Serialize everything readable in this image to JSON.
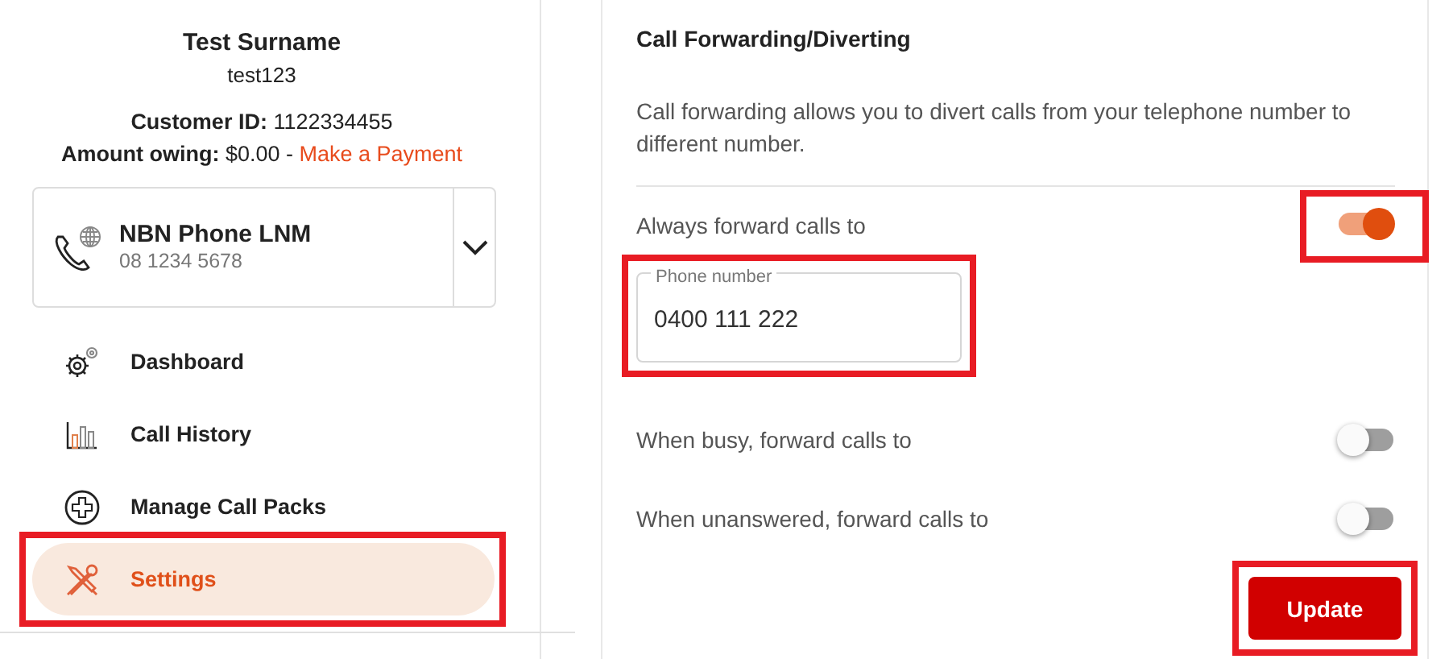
{
  "profile": {
    "name": "Test Surname",
    "username": "test123",
    "customer_id": "**Customer ID:** 1122334455",
    "amount": "**Amount owing:** $0.00 -",
    "payment_link": "Make a Payment"
  },
  "service": {
    "name": "NBN Phone LNM",
    "number": "08 1234 5678",
    "expanded": false
  },
  "nav": [
    {
      "label": "Dashboard",
      "selected": false,
      "highlighted": false
    },
    {
      "label": "Call History",
      "selected": false,
      "highlighted": false
    },
    {
      "label": "Manage Call Packs",
      "selected": false,
      "highlighted": false
    },
    {
      "label": "Settings",
      "selected": true,
      "highlighted": true
    }
  ],
  "panel": {
    "title": "Call Forwarding/Diverting",
    "description": "Call forwarding allows you to divert calls from your telephone number to different number.",
    "options": [
      {
        "label": "Always forward calls to",
        "on": true,
        "highlighted": true,
        "field": {
          "label": "Phone number",
          "value": "0400 111 222",
          "highlighted": true
        }
      },
      {
        "label": "When busy, forward calls to",
        "on": false,
        "highlighted": false
      },
      {
        "label": "When unanswered, forward calls to",
        "on": false,
        "highlighted": false
      }
    ],
    "button": {
      "label": "Update",
      "highlighted": true
    }
  }
}
